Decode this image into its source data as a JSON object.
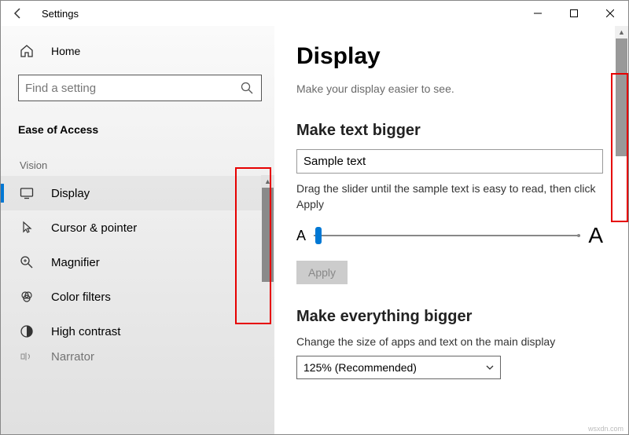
{
  "titlebar": {
    "title": "Settings"
  },
  "sidebar": {
    "home_label": "Home",
    "search_placeholder": "Find a setting",
    "category": "Ease of Access",
    "group": "Vision",
    "items": [
      {
        "label": "Display"
      },
      {
        "label": "Cursor & pointer"
      },
      {
        "label": "Magnifier"
      },
      {
        "label": "Color filters"
      },
      {
        "label": "High contrast"
      },
      {
        "label": "Narrator"
      }
    ]
  },
  "main": {
    "heading": "Display",
    "subtext": "Make your display easier to see.",
    "section1": {
      "heading": "Make text bigger",
      "sample": "Sample text",
      "instruction": "Drag the slider until the sample text is easy to read, then click Apply",
      "slider_small": "A",
      "slider_big": "A",
      "apply": "Apply"
    },
    "section2": {
      "heading": "Make everything bigger",
      "description": "Change the size of apps and text on the main display",
      "dropdown_value": "125% (Recommended)"
    }
  },
  "watermark": "wsxdn.com"
}
